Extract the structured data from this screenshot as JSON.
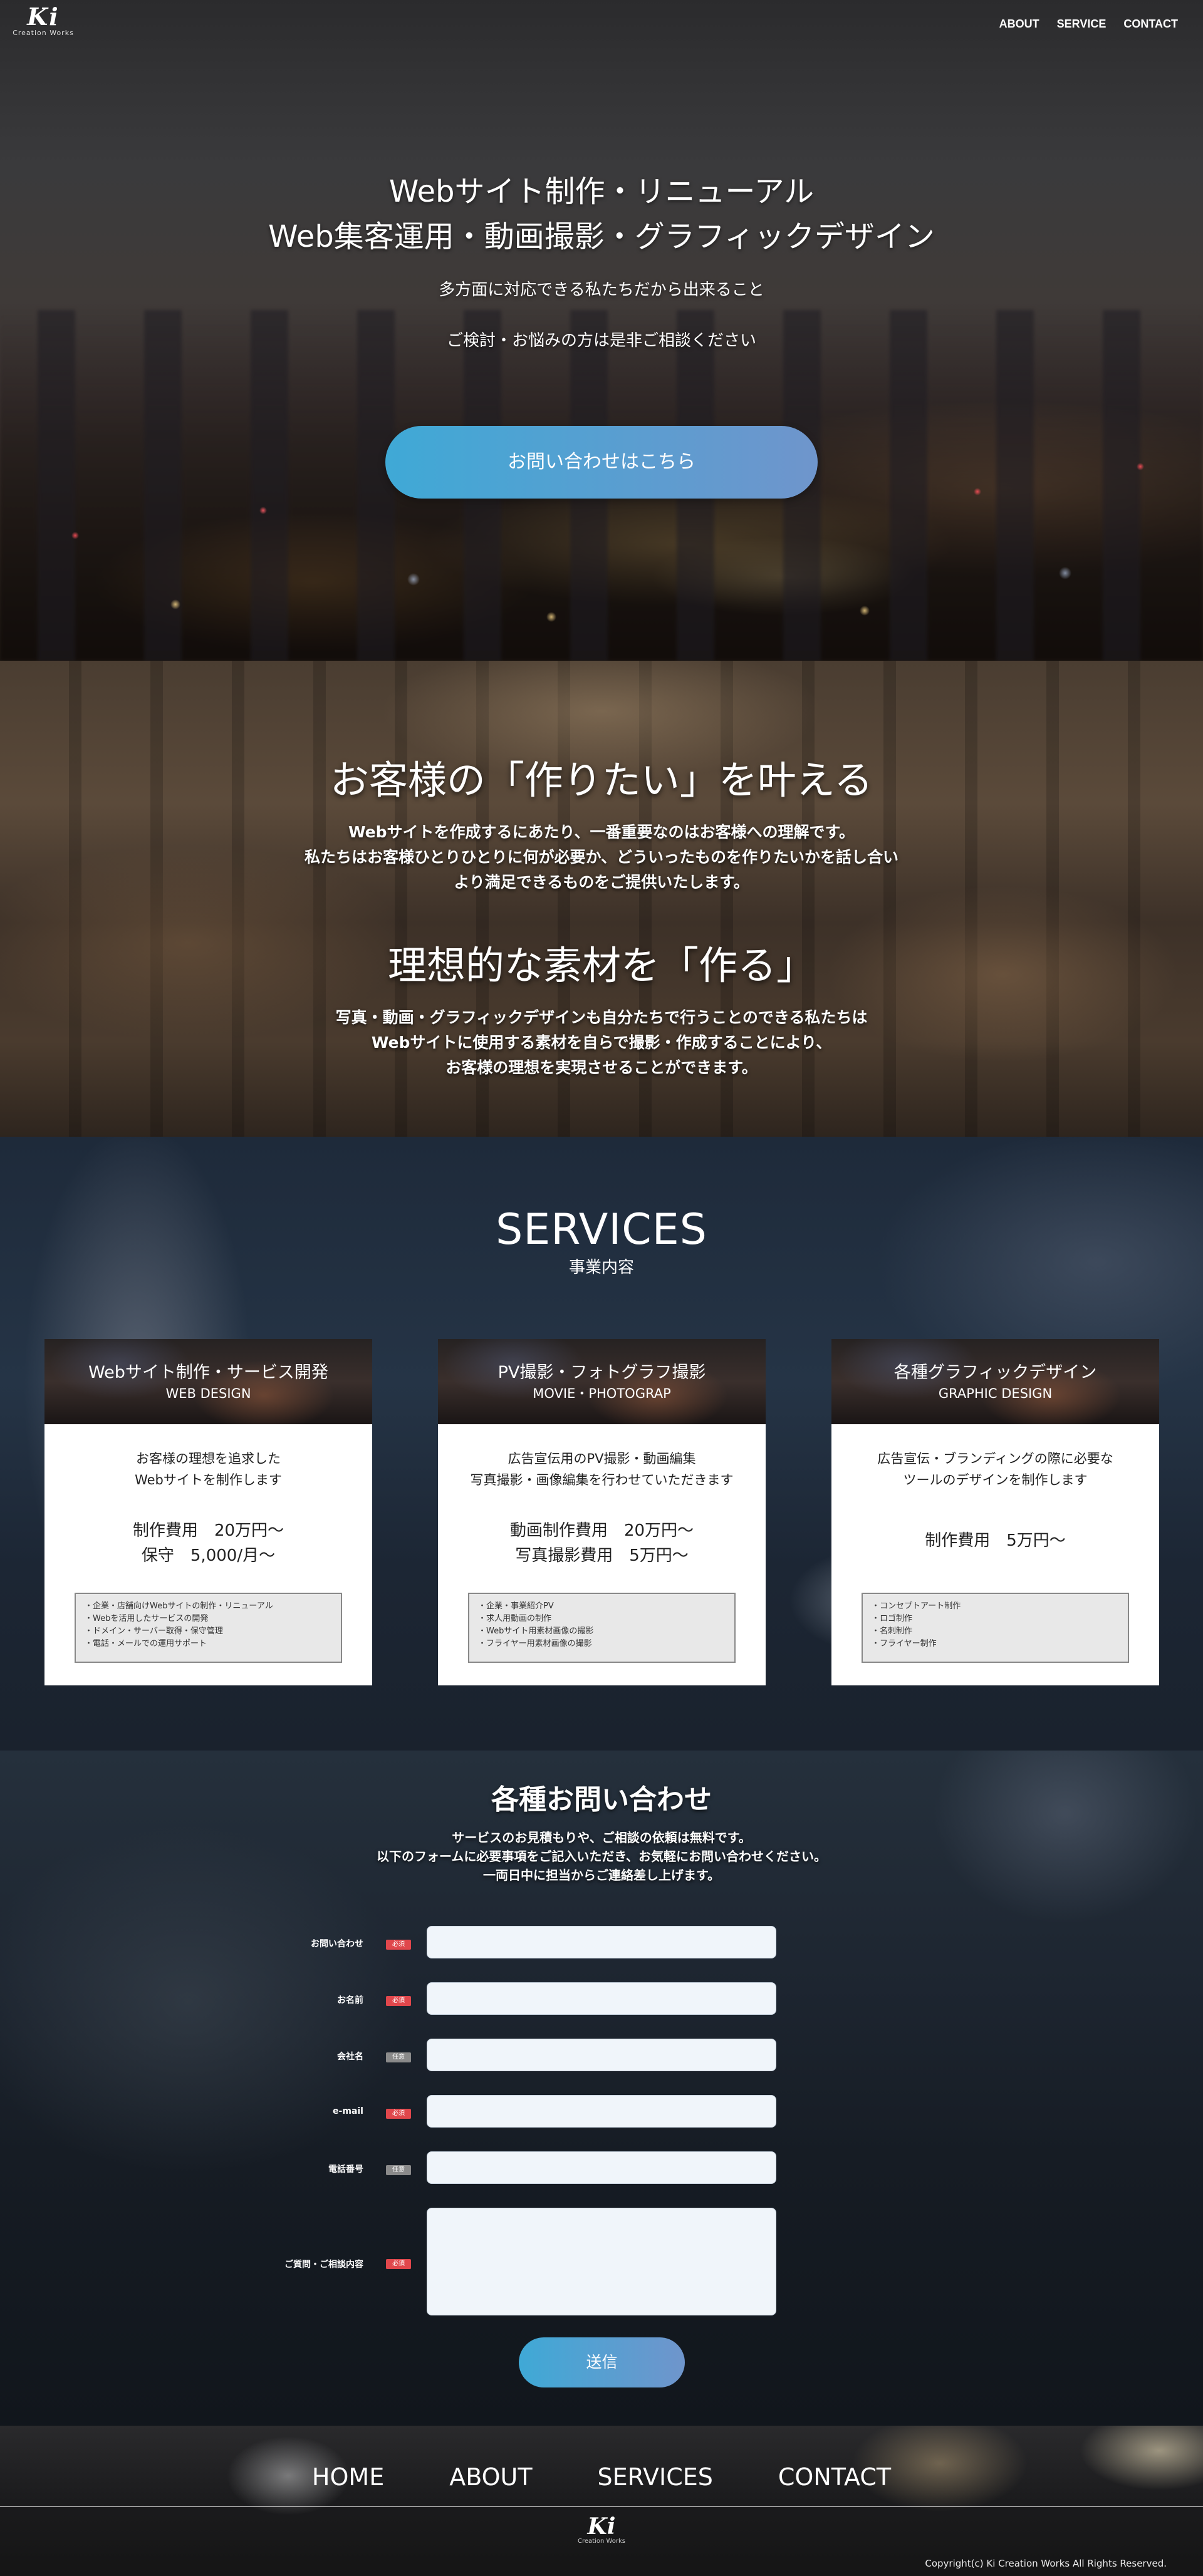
{
  "header": {
    "logo_mark": "Ki",
    "logo_sub": "Creation Works",
    "nav": [
      "ABOUT",
      "SERVICE",
      "CONTACT"
    ]
  },
  "hero": {
    "title_line1": "Webサイト制作・リニューアル",
    "title_line2": "Web集客運用・動画撮影・グラフィックデザイン",
    "line1": "多方面に対応できる私たちだから出来ること",
    "line2": "ご検討・お悩みの方は是非ご相談ください",
    "cta": "お問い合わせはこちら"
  },
  "about": {
    "heading1": "お客様の「作りたい」を叶える",
    "body1": [
      "Webサイトを作成するにあたり、一番重要なのはお客様への理解です。",
      "私たちはお客様ひとりひとりに何が必要か、どういったものを作りたいかを話し合い",
      "より満足できるものをご提供いたします。"
    ],
    "heading2": "理想的な素材を「作る」",
    "body2": [
      "写真・動画・グラフィックデザインも自分たちで行うことのできる私たちは",
      "Webサイトに使用する素材を自らで撮影・作成することにより、",
      "お客様の理想を実現させることができます。"
    ]
  },
  "services": {
    "title": "SERVICES",
    "subtitle": "事業内容",
    "cards": [
      {
        "title_ja": "Webサイト制作・サービス開発",
        "title_en": "WEB DESIGN",
        "desc": [
          "お客様の理想を追求した",
          "Webサイトを制作します"
        ],
        "price": [
          "制作費用　20万円〜",
          "保守　5,000/月〜"
        ],
        "list": [
          "・企業・店舗向けWebサイトの制作・リニューアル",
          "・Webを活用したサービスの開発",
          "・ドメイン・サーバー取得・保守管理",
          "・電話・メールでの運用サポート"
        ]
      },
      {
        "title_ja": "PV撮影・フォトグラフ撮影",
        "title_en": "MOVIE・PHOTOGRAP",
        "desc": [
          "広告宣伝用のPV撮影・動画編集",
          "写真撮影・画像編集を行わせていただきます"
        ],
        "price": [
          "動画制作費用　20万円〜",
          "写真撮影費用　5万円〜"
        ],
        "list": [
          "・企業・事業紹介PV",
          "・求人用動画の制作",
          "・Webサイト用素材画像の撮影",
          "・フライヤー用素材画像の撮影"
        ]
      },
      {
        "title_ja": "各種グラフィックデザイン",
        "title_en": "GRAPHIC DESIGN",
        "desc": [
          "広告宣伝・ブランディングの際に必要な",
          "ツールのデザインを制作します"
        ],
        "price": [
          "制作費用　5万円〜"
        ],
        "list": [
          "・コンセプトアート制作",
          "・ロゴ制作",
          "・名刺制作",
          "・フライヤー制作"
        ]
      }
    ]
  },
  "contact": {
    "title": "各種お問い合わせ",
    "lead": [
      "サービスのお見積もりや、ご相談の依頼は無料です。",
      "以下のフォームに必要事項をご記入いただき、お気軽にお問い合わせください。",
      "一両日中に担当からご連絡差し上げます。"
    ],
    "fields": [
      {
        "label": "お問い合わせ",
        "tag": "必須",
        "required": true
      },
      {
        "label": "お名前",
        "tag": "必須",
        "required": true
      },
      {
        "label": "会社名",
        "tag": "任意",
        "required": false
      },
      {
        "label": "e-mail",
        "tag": "必須",
        "required": true
      },
      {
        "label": "電話番号",
        "tag": "任意",
        "required": false
      },
      {
        "label": "ご質問・ご相談内容",
        "tag": "必須",
        "required": true
      }
    ],
    "submit": "送信"
  },
  "footer": {
    "nav": [
      "HOME",
      "ABOUT",
      "SERVICES",
      "CONTACT"
    ],
    "logo_mark": "Ki",
    "logo_sub": "Creation Works",
    "copyright": "Copyright(c) Ki Creation Works All Rights Reserved."
  },
  "colors": {
    "accent_gradient_start": "#3fa9d6",
    "accent_gradient_end": "#6f95cc",
    "required_tag": "#e0474c",
    "optional_tag": "#8a8a8a"
  }
}
